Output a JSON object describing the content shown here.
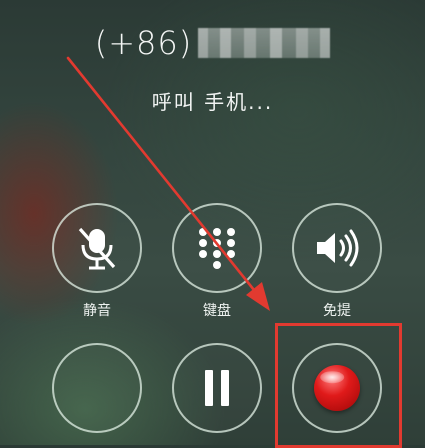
{
  "call": {
    "country_code": "(+86)",
    "status": "呼叫 手机..."
  },
  "buttons": {
    "mute_label": "静音",
    "keypad_label": "键盘",
    "speaker_label": "免提"
  },
  "colors": {
    "ring": "#e1f0e6",
    "record_red": "#e01a1a",
    "annotation_red": "#e23a30"
  },
  "icons": {
    "mute": "microphone-slash-icon",
    "keypad": "keypad-grid-icon",
    "speaker": "speaker-icon",
    "hold": "pause-icon",
    "record": "record-icon"
  }
}
